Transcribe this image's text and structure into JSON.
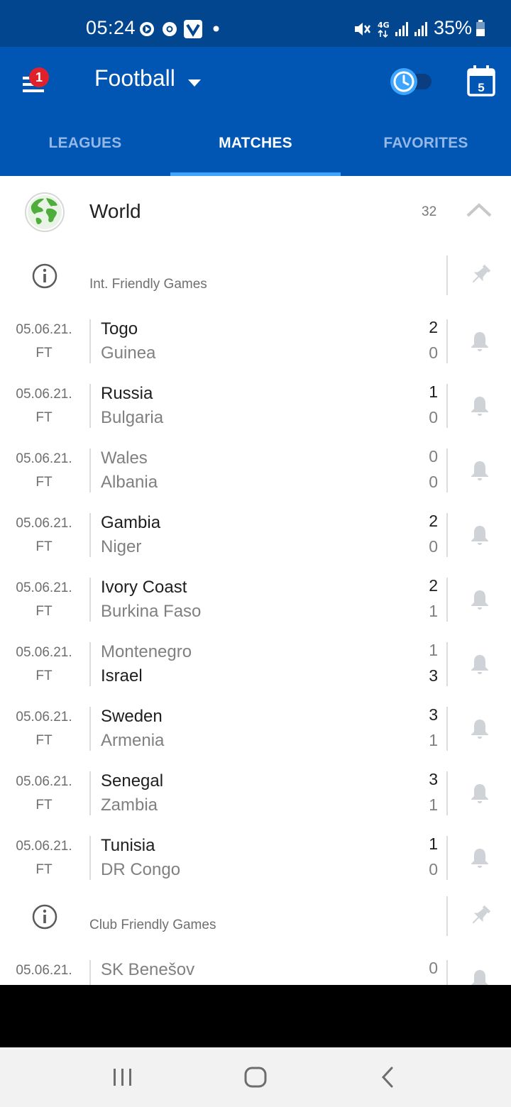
{
  "status_bar": {
    "time": "05:24",
    "battery": "35%",
    "icons": [
      "media-icon",
      "chrome-icon",
      "vpn-icon",
      "dot-icon",
      "mute-icon",
      "4g-icon",
      "signal-icon",
      "signal-icon",
      "battery-icon"
    ]
  },
  "app_bar": {
    "notification_count": "1",
    "sport": "Football",
    "calendar_day": "5",
    "tabs": [
      {
        "label": "LEAGUES",
        "active": false
      },
      {
        "label": "MATCHES",
        "active": true
      },
      {
        "label": "FAVORITES",
        "active": false
      }
    ]
  },
  "region": {
    "name": "World",
    "count": "32"
  },
  "leagues": [
    {
      "name": "Int. Friendly Games",
      "matches": [
        {
          "date": "05.06.21.",
          "status": "FT",
          "home": "Togo",
          "away": "Guinea",
          "home_score": "2",
          "away_score": "0"
        },
        {
          "date": "05.06.21.",
          "status": "FT",
          "home": "Russia",
          "away": "Bulgaria",
          "home_score": "1",
          "away_score": "0"
        },
        {
          "date": "05.06.21.",
          "status": "FT",
          "home": "Wales",
          "away": "Albania",
          "home_score": "0",
          "away_score": "0"
        },
        {
          "date": "05.06.21.",
          "status": "FT",
          "home": "Gambia",
          "away": "Niger",
          "home_score": "2",
          "away_score": "0"
        },
        {
          "date": "05.06.21.",
          "status": "FT",
          "home": "Ivory Coast",
          "away": "Burkina Faso",
          "home_score": "2",
          "away_score": "1"
        },
        {
          "date": "05.06.21.",
          "status": "FT",
          "home": "Montenegro",
          "away": "Israel",
          "home_score": "1",
          "away_score": "3"
        },
        {
          "date": "05.06.21.",
          "status": "FT",
          "home": "Sweden",
          "away": "Armenia",
          "home_score": "3",
          "away_score": "1"
        },
        {
          "date": "05.06.21.",
          "status": "FT",
          "home": "Senegal",
          "away": "Zambia",
          "home_score": "3",
          "away_score": "1"
        },
        {
          "date": "05.06.21.",
          "status": "FT",
          "home": "Tunisia",
          "away": "DR Congo",
          "home_score": "1",
          "away_score": "0"
        }
      ]
    },
    {
      "name": "Club Friendly Games",
      "matches": [
        {
          "date": "05.06.21.",
          "status": "",
          "home": "SK Benešov",
          "away": "",
          "home_score": "0",
          "away_score": ""
        }
      ]
    }
  ],
  "colors": {
    "status_bar": "#01468f",
    "app_bar": "#0156b3",
    "tab_indicator": "#3ea5ff",
    "badge": "#e0212b"
  }
}
